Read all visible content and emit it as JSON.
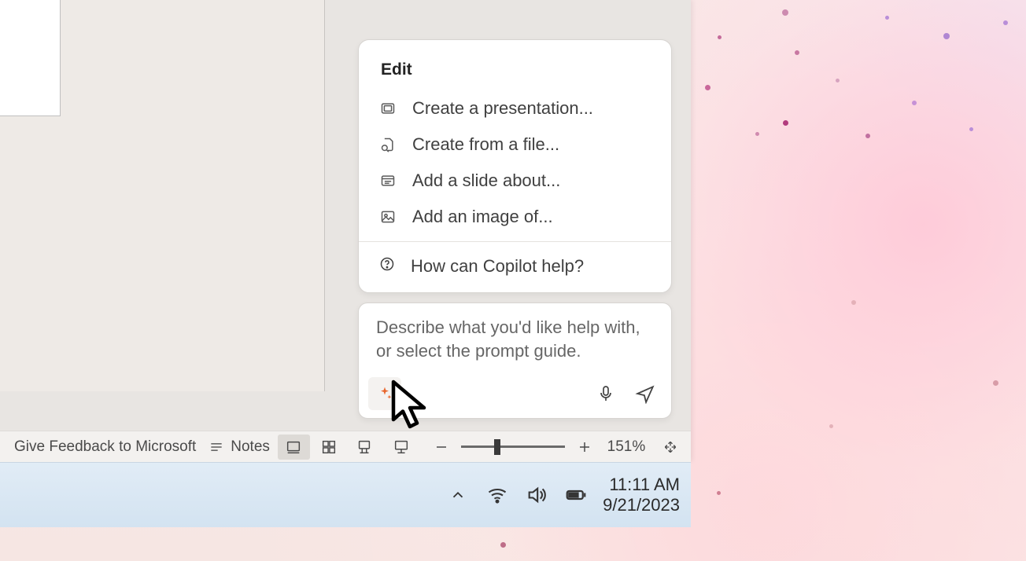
{
  "copilot": {
    "section_label": "Edit",
    "items": [
      {
        "label": "Create a presentation..."
      },
      {
        "label": "Create from a file..."
      },
      {
        "label": "Add a slide about..."
      },
      {
        "label": "Add an image of..."
      }
    ],
    "help_label": "How can Copilot help?",
    "placeholder": "Describe what you'd like help with, or select the prompt guide."
  },
  "statusbar": {
    "feedback_label": "Give Feedback to Microsoft",
    "notes_label": "Notes",
    "zoom_pct": "151%"
  },
  "tray": {
    "time": "11:11 AM",
    "date": "9/21/2023"
  }
}
